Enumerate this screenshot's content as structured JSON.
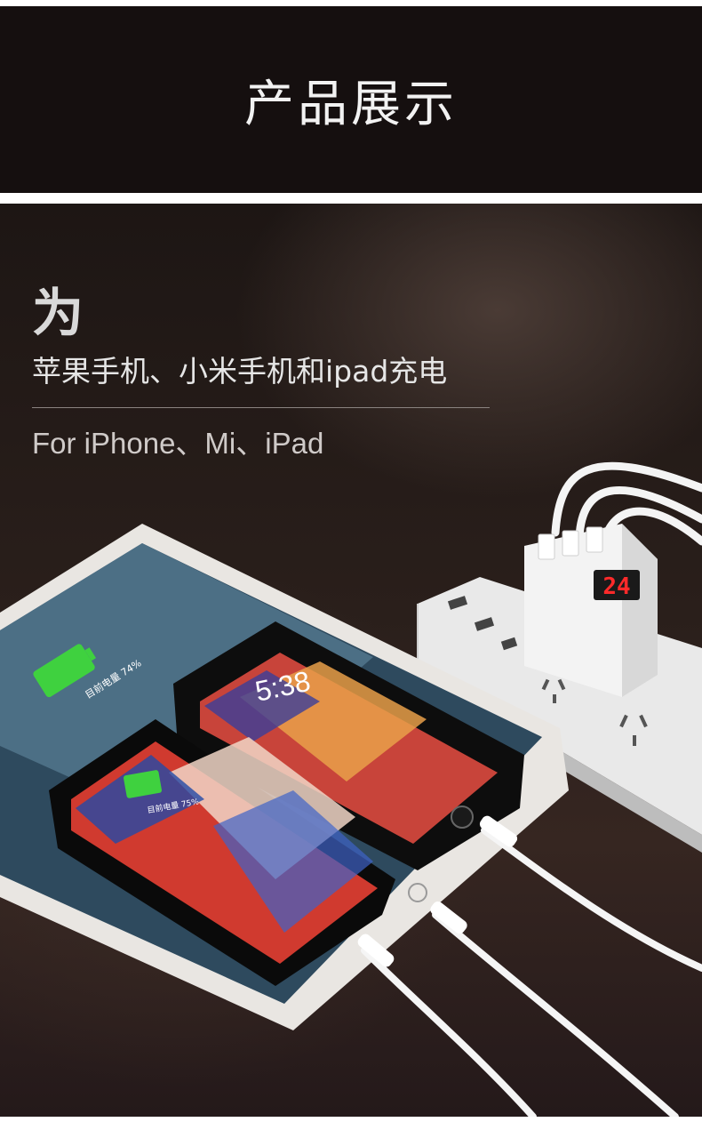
{
  "header": {
    "title": "产品展示"
  },
  "headline": {
    "char": "为",
    "subtitle": "苹果手机、小米手机和ipad充电",
    "english": "For iPhone、Mi、iPad"
  },
  "devices": {
    "ipad_battery": "目前电量 74%",
    "iphone_x_battery": "目前电量 75%",
    "phone_time": "5:38",
    "charger_display": "24"
  },
  "colors": {
    "header_bg": "#150f0f",
    "battery_green": "#3fd13f",
    "display_red": "#ff2a2a"
  }
}
